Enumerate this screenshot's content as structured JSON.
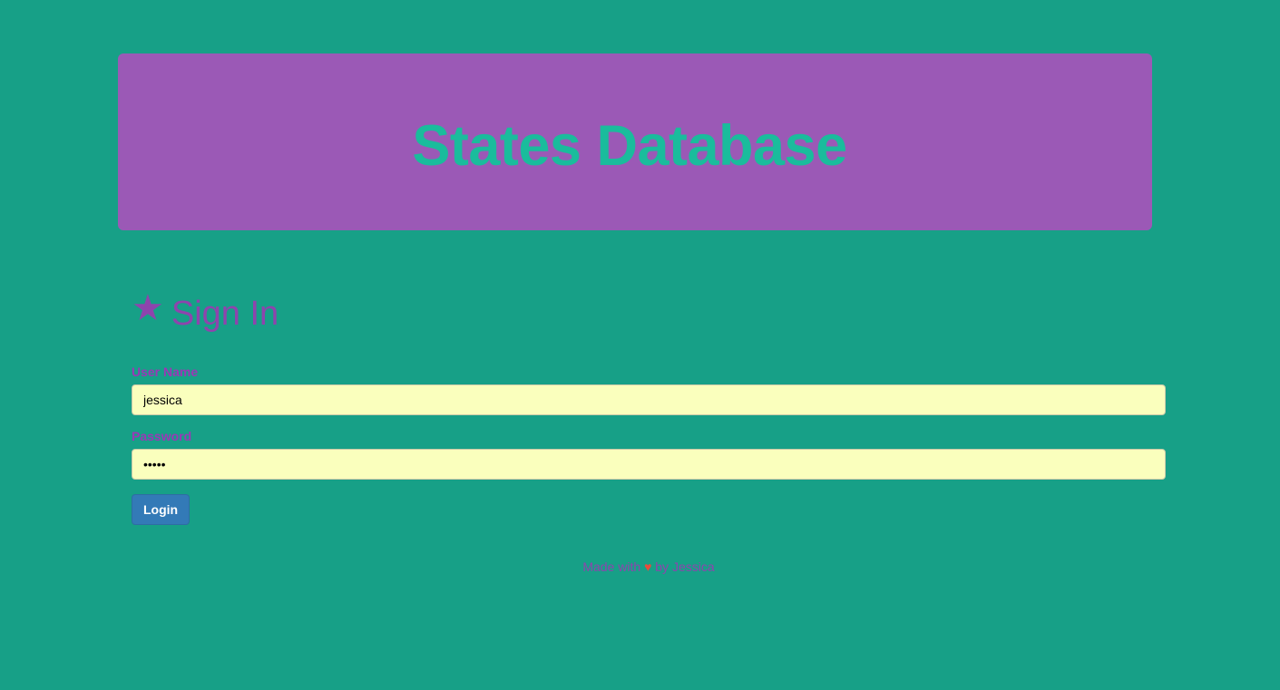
{
  "header": {
    "title": "States Database"
  },
  "signin": {
    "icon": "star-icon",
    "heading": "Sign In",
    "username": {
      "label": "User Name",
      "value": "jessica"
    },
    "password": {
      "label": "Password",
      "value": "•••••"
    },
    "login_label": "Login"
  },
  "footer": {
    "prefix": "Made with",
    "heart": "♥",
    "suffix": "by Jessica"
  },
  "colors": {
    "background": "#17a087",
    "header_bg": "#9b59b6",
    "header_text": "#1abc9c",
    "accent": "#8e44ad",
    "input_bg": "#faffbd",
    "button_bg": "#337ab7",
    "heart": "#e74c3c"
  }
}
